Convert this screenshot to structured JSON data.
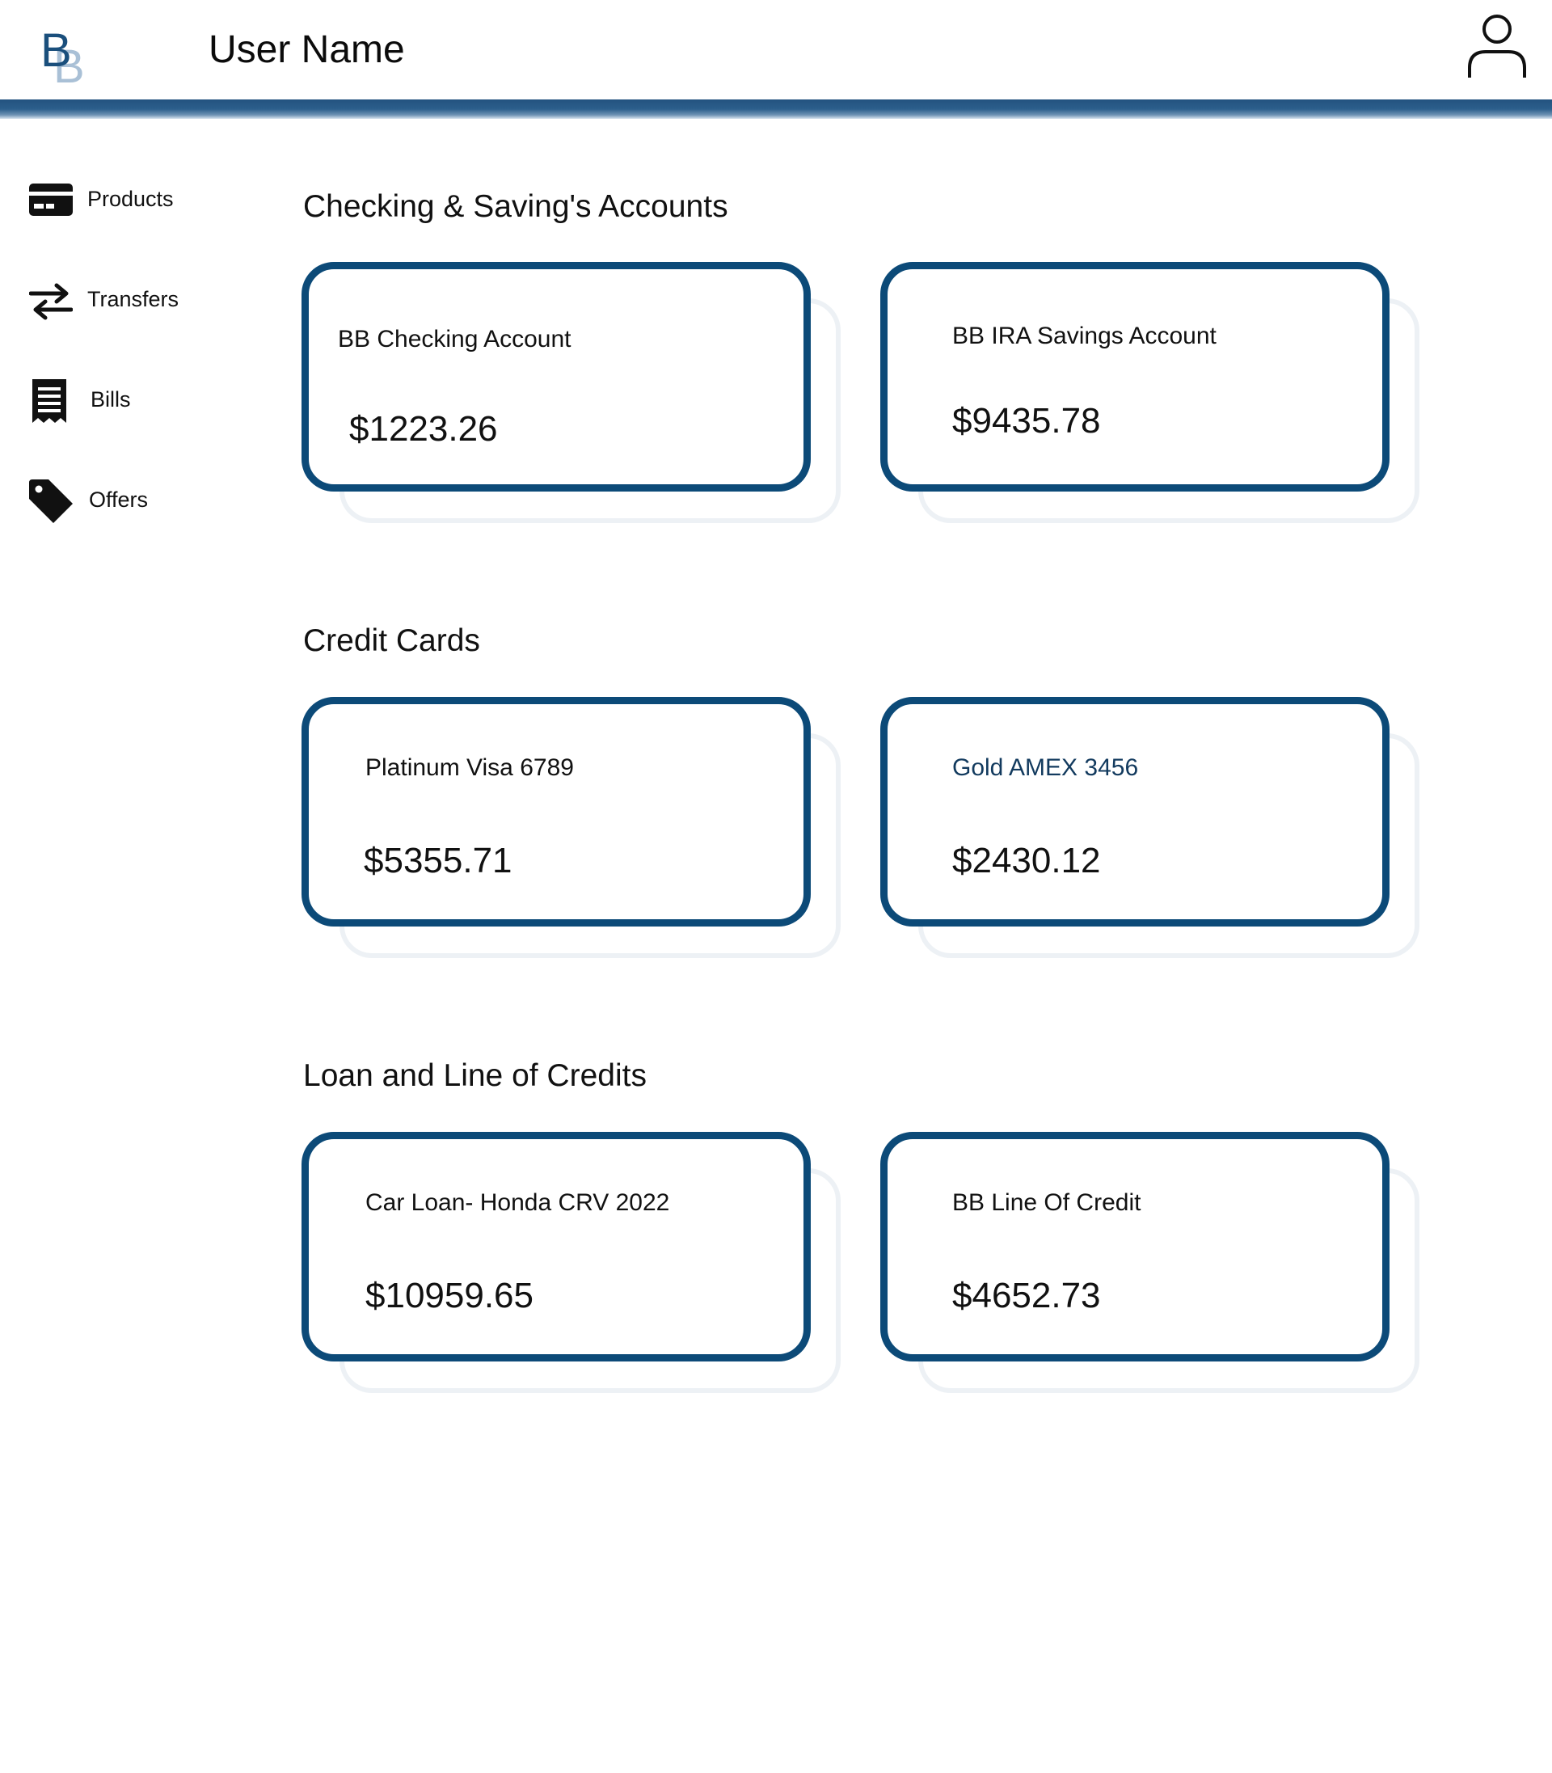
{
  "header": {
    "user_name": "User Name",
    "logo_icon": "bb-logo-icon",
    "profile_icon": "user-profile-icon",
    "brand_color": "#0c4a78"
  },
  "sidebar": {
    "items": [
      {
        "label": "Products",
        "icon": "credit-card-icon"
      },
      {
        "label": "Transfers",
        "icon": "transfer-arrows-icon"
      },
      {
        "label": "Bills",
        "icon": "receipt-icon"
      },
      {
        "label": "Offers",
        "icon": "price-tag-icon"
      }
    ]
  },
  "sections": [
    {
      "title": "Checking & Saving's Accounts",
      "cards": [
        {
          "name": "BB Checking Account",
          "amount": "$1223.26"
        },
        {
          "name": "BB IRA Savings Account",
          "amount": "$9435.78"
        }
      ]
    },
    {
      "title": "Credit Cards",
      "cards": [
        {
          "name": "Platinum Visa 6789",
          "amount": "$5355.71"
        },
        {
          "name": "Gold AMEX 3456",
          "amount": "$2430.12"
        }
      ]
    },
    {
      "title": "Loan and Line of Credits",
      "cards": [
        {
          "name": "Car Loan- Honda CRV 2022",
          "amount": "$10959.65"
        },
        {
          "name": "BB Line Of Credit",
          "amount": "$4652.73"
        }
      ]
    }
  ]
}
